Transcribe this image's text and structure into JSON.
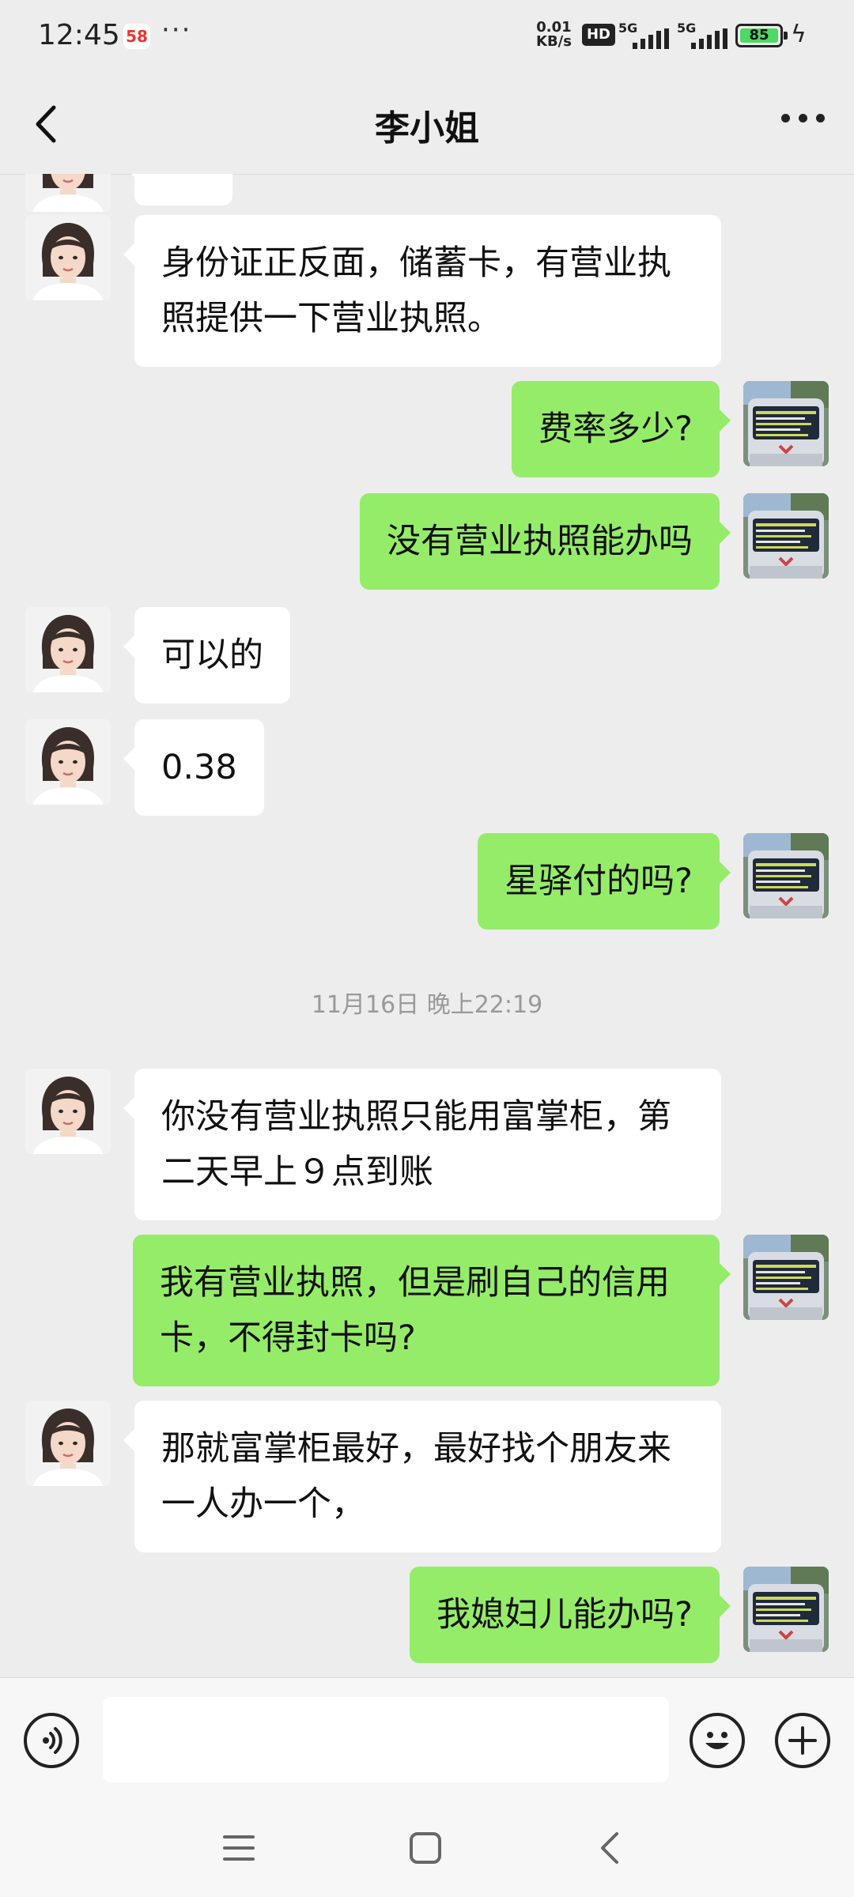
{
  "status_bar": {
    "time": "12:45",
    "app_badge": "58",
    "more_dots": "···",
    "net_speed_value": "0.01",
    "net_speed_unit": "KB/s",
    "hd_label": "HD",
    "signal_1_label": "5G",
    "signal_2_label": "5G",
    "battery_level": "85"
  },
  "header": {
    "title": "李小姐"
  },
  "messages": [
    {
      "side": "in",
      "text": "身份证正反面，储蓄卡，有营业执照提供一下营业执照。"
    },
    {
      "side": "out",
      "text": "费率多少?"
    },
    {
      "side": "out",
      "text": "没有营业执照能办吗"
    },
    {
      "side": "in",
      "text": "可以的"
    },
    {
      "side": "in",
      "text": "0.38"
    },
    {
      "side": "out",
      "text": "星驿付的吗?"
    },
    {
      "side": "time",
      "text": "11月16日 晚上22:19"
    },
    {
      "side": "in",
      "text": "你没有营业执照只能用富掌柜，第二天早上９点到账"
    },
    {
      "side": "out",
      "text": "我有营业执照，但是刷自己的信用卡，不得封卡吗?"
    },
    {
      "side": "in",
      "text": "那就富掌柜最好，最好找个朋友来一人办一个，"
    },
    {
      "side": "out",
      "text": "我媳妇儿能办吗?"
    }
  ],
  "input_bar": {
    "placeholder": ""
  },
  "colors": {
    "background": "#ededed",
    "bubble_out": "#95ec69",
    "bubble_in": "#ffffff",
    "battery": "#4cd964"
  }
}
